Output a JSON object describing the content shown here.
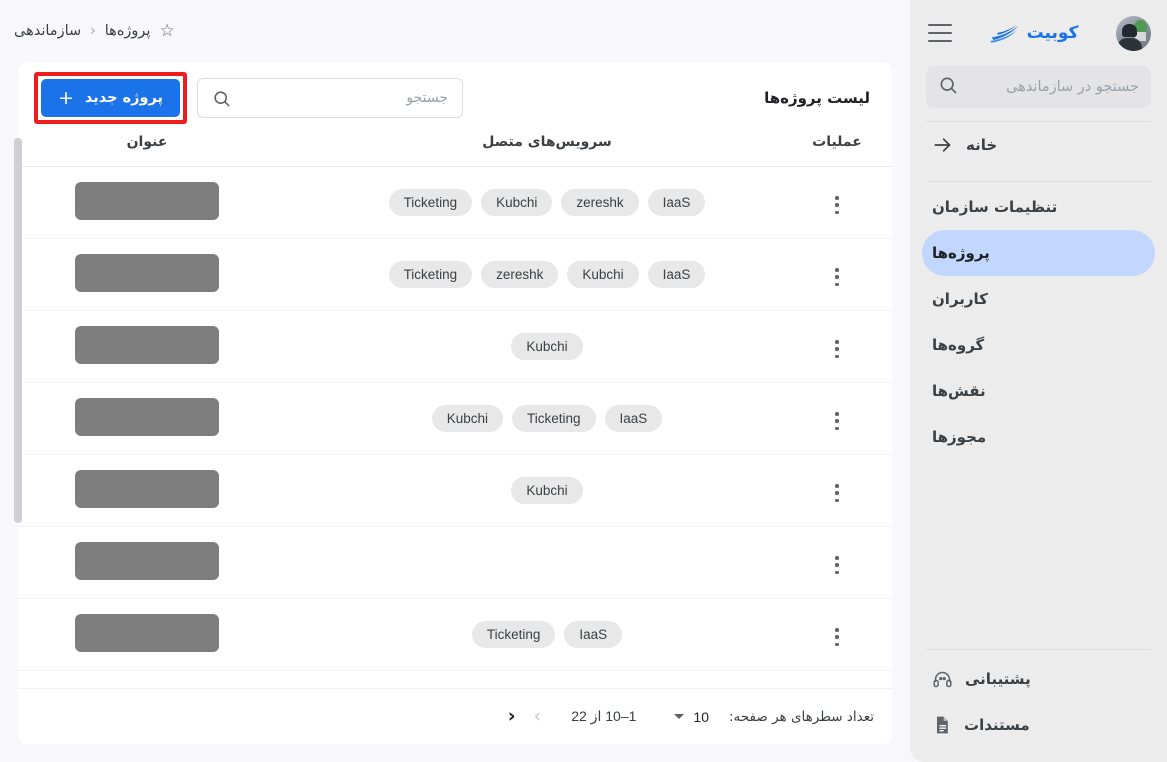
{
  "app": {
    "brand_name": "کوبیت",
    "accent_color": "#1a73e8",
    "highlight_color": "#ee1c1c"
  },
  "sidebar": {
    "search_placeholder": "جستجو در سازماندهی",
    "menu_icon": "hamburger-icon",
    "search_icon": "search-icon",
    "avatar_alt": "avatar",
    "items": [
      {
        "label": "خانه",
        "icon": "arrow-right-icon",
        "active": false
      },
      {
        "label": "تنظیمات سازمان",
        "icon": "",
        "active": false
      },
      {
        "label": "پروژه‌ها",
        "icon": "",
        "active": true
      },
      {
        "label": "کاربران",
        "icon": "",
        "active": false
      },
      {
        "label": "گروه‌ها",
        "icon": "",
        "active": false
      },
      {
        "label": "نقش‌ها",
        "icon": "",
        "active": false
      },
      {
        "label": "مجوزها",
        "icon": "",
        "active": false
      }
    ],
    "bottom_items": [
      {
        "label": "پشتیبانی",
        "icon": "headset-icon"
      },
      {
        "label": "مستندات",
        "icon": "document-icon"
      }
    ]
  },
  "breadcrumb": {
    "items": [
      "سازماندهی",
      "پروژه‌ها"
    ],
    "separator": "‹",
    "star_icon": "star-outline-icon"
  },
  "toolbar": {
    "list_title": "لیست پروژه‌ها",
    "search_placeholder": "جستجو",
    "search_icon": "search-icon",
    "new_project_label": "پروژه جدید",
    "new_project_plus": "+"
  },
  "table": {
    "headers": {
      "title": "عنوان",
      "services": "سرویس‌های متصل",
      "operations": "عملیات"
    },
    "row_menu_icon": "kebab-menu-icon",
    "rows": [
      {
        "title_redacted": true,
        "services": [
          "IaaS",
          "zereshk",
          "Kubchi",
          "Ticketing"
        ]
      },
      {
        "title_redacted": true,
        "services": [
          "IaaS",
          "Kubchi",
          "zereshk",
          "Ticketing"
        ]
      },
      {
        "title_redacted": true,
        "services": [
          "Kubchi"
        ]
      },
      {
        "title_redacted": true,
        "services": [
          "IaaS",
          "Ticketing",
          "Kubchi"
        ]
      },
      {
        "title_redacted": true,
        "services": [
          "Kubchi"
        ]
      },
      {
        "title_redacted": true,
        "services": []
      },
      {
        "title_redacted": true,
        "services": [
          "IaaS",
          "Ticketing"
        ]
      }
    ]
  },
  "pagination": {
    "rows_per_page_label": "تعداد سطرهای هر صفحه:",
    "rows_per_page_value": "10",
    "range_text": "1–10 از 22",
    "prev_icon": "chevron-right-icon",
    "next_icon": "chevron-left-icon",
    "prev_enabled": true,
    "next_enabled": false
  }
}
